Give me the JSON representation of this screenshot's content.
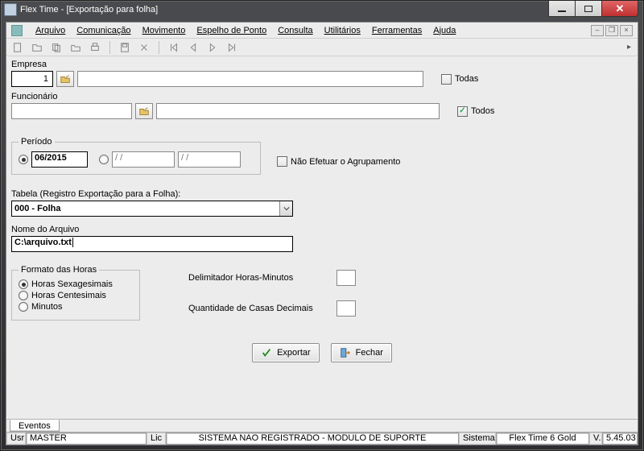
{
  "window": {
    "title": "Flex Time - [Exportação para folha]"
  },
  "menu": {
    "arquivo": "Arquivo",
    "comunicacao": "Comunicação",
    "movimento": "Movimento",
    "espelho": "Espelho de Ponto",
    "consulta": "Consulta",
    "utilitarios": "Utilitários",
    "ferramentas": "Ferramentas",
    "ajuda": "Ajuda"
  },
  "labels": {
    "empresa": "Empresa",
    "todas": "Todas",
    "funcionario": "Funcionário",
    "todos": "Todos",
    "periodo": "Período",
    "nao_agrup": "Não Efetuar o Agrupamento",
    "tabela": "Tabela (Registro Exportação para a Folha):",
    "nome_arquivo": "Nome do Arquivo",
    "formato_horas": "Formato das Horas",
    "horas_sex": "Horas Sexagesimais",
    "horas_cent": "Horas Centesimais",
    "minutos": "Minutos",
    "delimitador": "Delimitador Horas-Minutos",
    "casas_decimais": "Quantidade de Casas Decimais",
    "exportar": "Exportar",
    "fechar": "Fechar",
    "eventos_tab": "Eventos"
  },
  "values": {
    "empresa_code": "1",
    "empresa_desc": "",
    "funcionario_desc": "",
    "periodo_1": "06/2015",
    "periodo_2": "  /  /    ",
    "periodo_3": "  /  /    ",
    "todas_checked": false,
    "todos_checked": true,
    "periodo_sel": 1,
    "nao_agrup_checked": false,
    "tabela_sel": "000 - Folha",
    "arquivo": "C:\\arquivo.txt",
    "formato_sel": "sex",
    "delimitador": "",
    "casas": ""
  },
  "status": {
    "usr_lbl": "Usr",
    "usr_val": "MASTER",
    "lic_lbl": "Lic",
    "lic_val": "SISTEMA NAO REGISTRADO - MODULO DE SUPORTE",
    "sistema_lbl": "Sistema",
    "sistema_val": "Flex Time 6 Gold",
    "ver_lbl": "V.",
    "ver_val": "5.45.03"
  }
}
